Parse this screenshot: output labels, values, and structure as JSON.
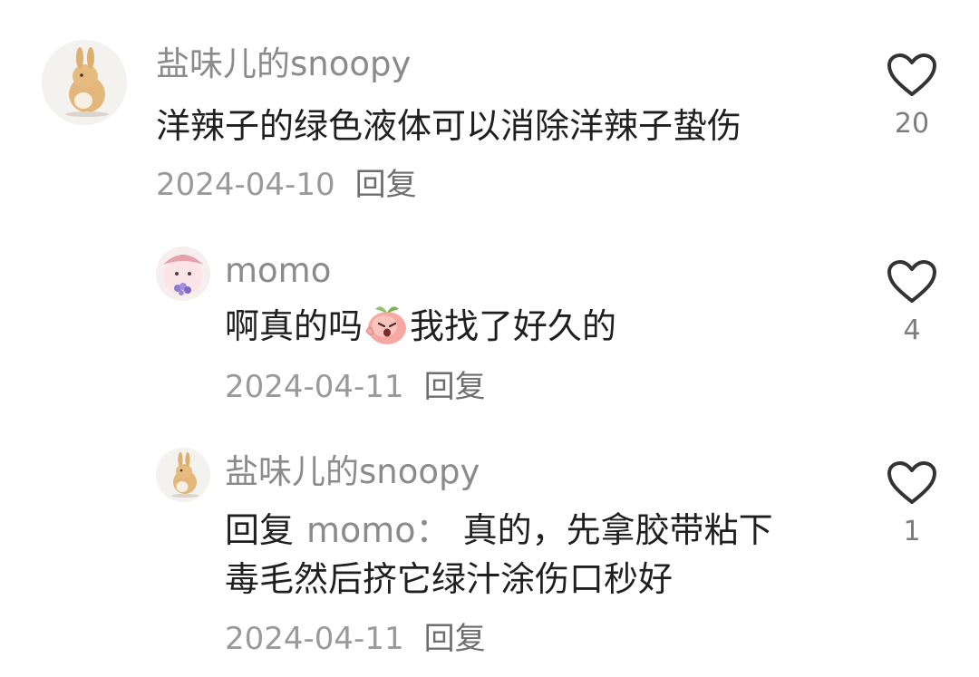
{
  "comments": [
    {
      "username": "盐味儿的snoopy",
      "text": "洋辣子的绿色液体可以消除洋辣子蛰伤",
      "date": "2024-04-10",
      "reply_label": "回复",
      "likes": "20",
      "avatar": "bunny-avatar"
    },
    {
      "username": "momo",
      "text_before_emoji": "啊真的吗",
      "emoji": "peach-emoji",
      "text_after_emoji": "我找了好久的",
      "date": "2024-04-11",
      "reply_label": "回复",
      "likes": "4",
      "avatar": "peach-flower-avatar"
    },
    {
      "username": "盐味儿的snoopy",
      "reply_prefix": "回复",
      "mention": "momo：",
      "text_line1": "真的，先拿胶带粘下",
      "text_line2": "毒毛然后挤它绿汁涂伤口秒好",
      "date": "2024-04-11",
      "reply_label": "回复",
      "likes": "1",
      "avatar": "bunny-avatar"
    }
  ]
}
